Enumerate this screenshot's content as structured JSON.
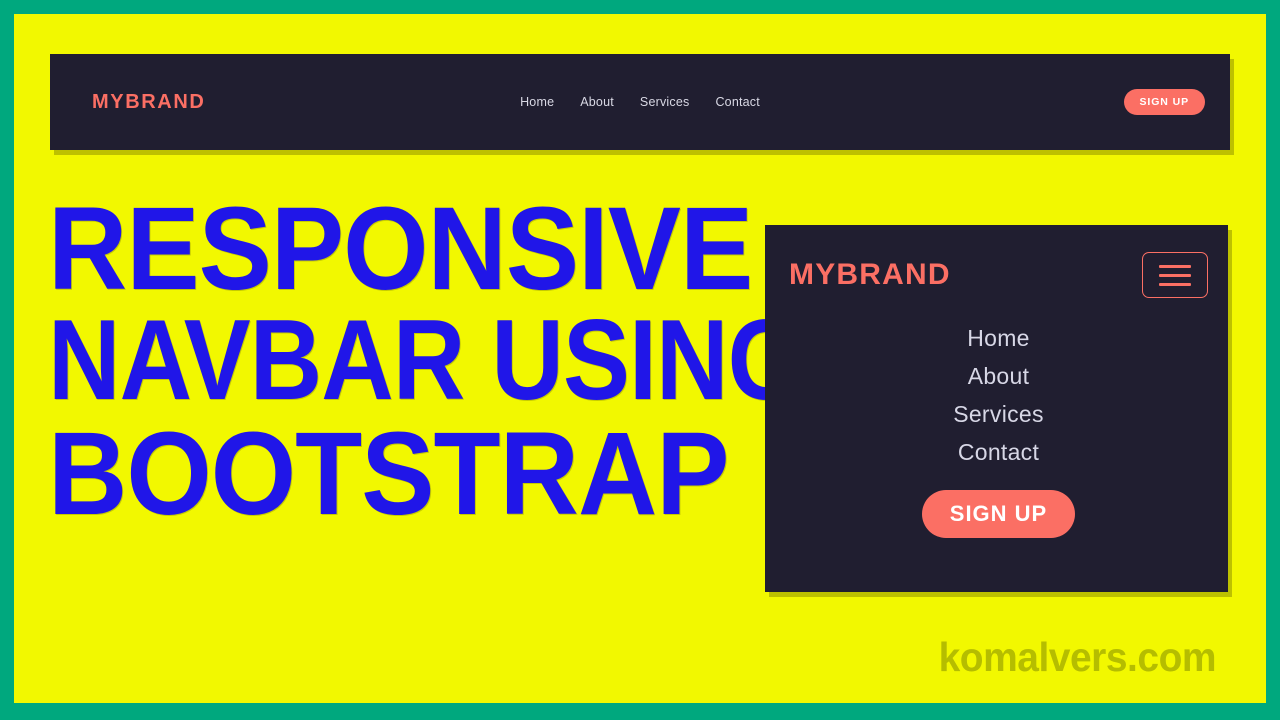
{
  "frame": {
    "border_color": "#00a87e",
    "background_color": "#f2f800"
  },
  "desktop_navbar": {
    "brand": "MYBRAND",
    "background_color": "#201e30",
    "accent_color": "#fb6f64",
    "links": [
      {
        "label": "Home"
      },
      {
        "label": "About"
      },
      {
        "label": "Services"
      },
      {
        "label": "Contact"
      }
    ],
    "signup_label": "SIGN UP"
  },
  "headline": {
    "color": "#2016e8",
    "line1": "RESPONSIVE",
    "line2": "NAVBAR USING",
    "line3": "BOOTSTRAP"
  },
  "mobile_card": {
    "brand": "MYBRAND",
    "background_color": "#201e30",
    "accent_color": "#fb6f64",
    "toggler_icon": "hamburger-icon",
    "links": [
      {
        "label": "Home"
      },
      {
        "label": "About"
      },
      {
        "label": "Services"
      },
      {
        "label": "Contact"
      }
    ],
    "signup_label": "SIGN UP"
  },
  "watermark": {
    "text": "komalvers.com",
    "color": "#b5bd00"
  }
}
